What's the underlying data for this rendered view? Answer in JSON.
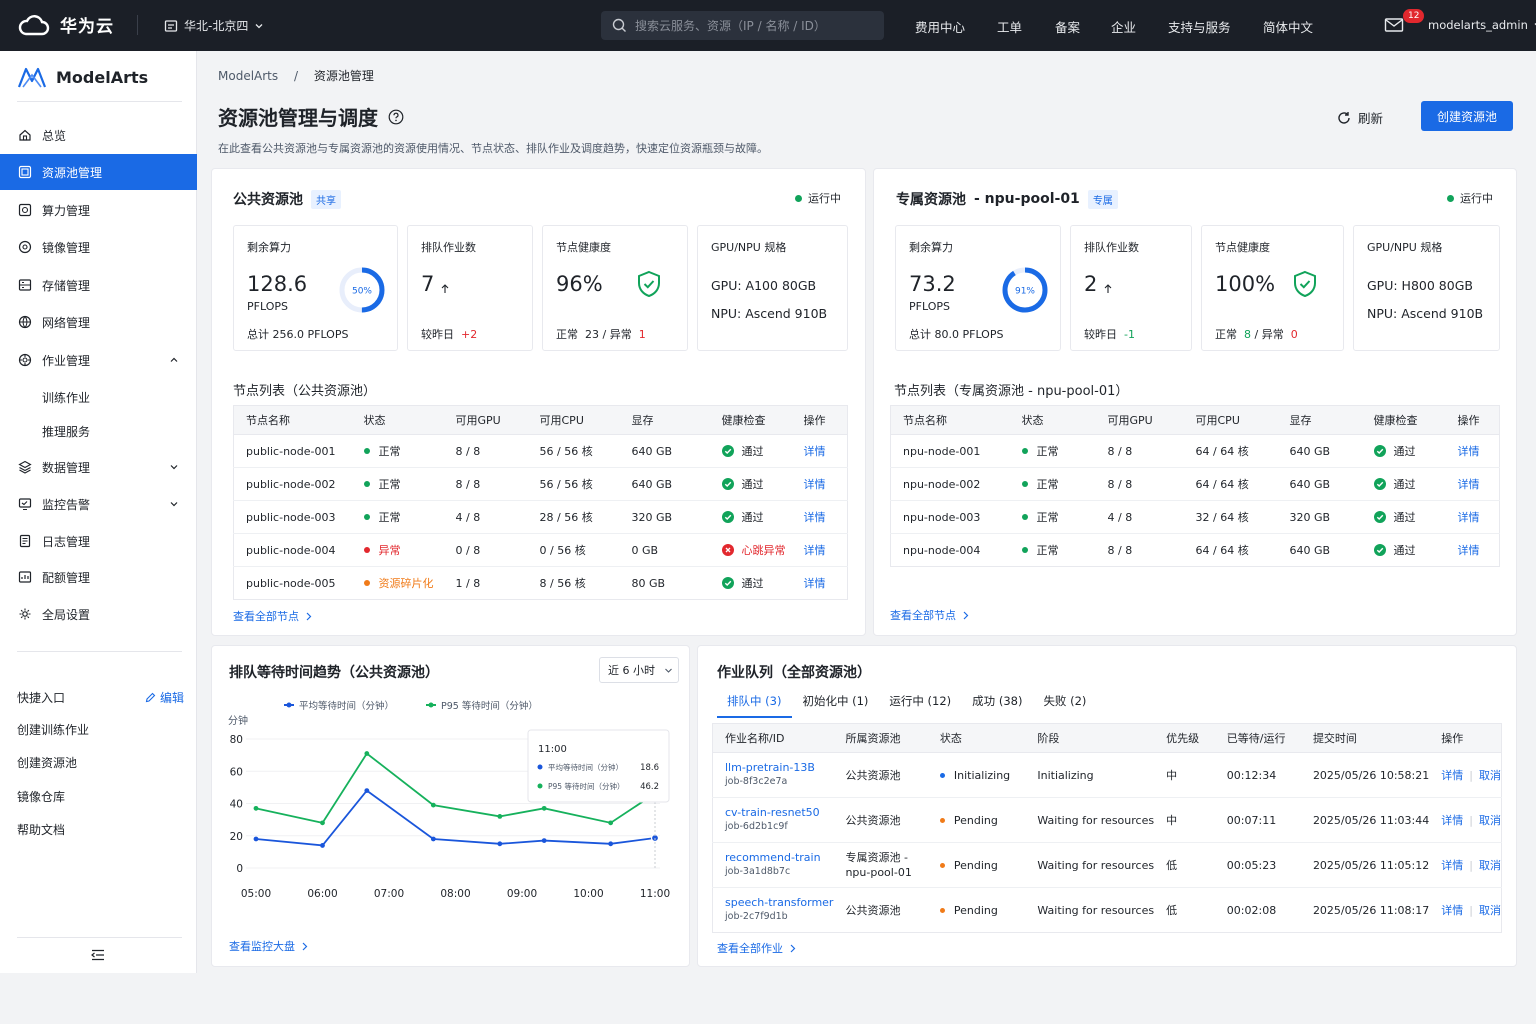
{
  "topbar": {
    "brand": "华为云",
    "region": "华北-北京四",
    "search_placeholder": "搜索云服务、资源（IP / 名称 / ID）",
    "nav": [
      "费用中心",
      "工单",
      "备案",
      "企业",
      "支持与服务",
      "简体中文"
    ],
    "mail_count": "12",
    "username": "modelarts_admin"
  },
  "sidebar": {
    "brand": "ModelArts",
    "items": [
      {
        "label": "总览",
        "icon": "home-icon"
      },
      {
        "label": "资源池管理",
        "icon": "resource-pool-icon"
      },
      {
        "label": "算力管理",
        "icon": "compute-icon"
      },
      {
        "label": "镜像管理",
        "icon": "image-icon"
      },
      {
        "label": "存储管理",
        "icon": "storage-icon"
      },
      {
        "label": "网络管理",
        "icon": "network-icon"
      },
      {
        "label": "作业管理",
        "icon": "job-icon"
      },
      {
        "label": "数据管理",
        "icon": "data-icon"
      },
      {
        "label": "监控告警",
        "icon": "monitor-icon"
      },
      {
        "label": "日志管理",
        "icon": "log-icon"
      },
      {
        "label": "配额管理",
        "icon": "quota-icon"
      },
      {
        "label": "全局设置",
        "icon": "settings-icon"
      }
    ],
    "job_sub": [
      "训练作业",
      "推理服务"
    ],
    "quick_title": "快捷入口",
    "quick_edit": "编辑",
    "quick_links": [
      "创建训练作业",
      "创建资源池",
      "镜像仓库",
      "帮助文档"
    ]
  },
  "breadcrumb": {
    "root": "ModelArts",
    "sep": "/",
    "current": "资源池管理"
  },
  "page": {
    "title": "资源池管理与调度",
    "desc": "在此查看公共资源池与专属资源池的资源使用情况、节点状态、排队作业及调度趋势，快速定位资源瓶颈与故障。",
    "refresh": "刷新",
    "create": "创建资源池"
  },
  "public_pool": {
    "title": "公共资源池",
    "tag": "共享",
    "status": "运行中",
    "remaining_label": "剩余算力",
    "remaining_value": "128.6",
    "remaining_unit": "PFLOPS",
    "ring_label": "50%",
    "ring_fraction": 0.5,
    "remaining_total": "总计 256.0 PFLOPS",
    "queue_label": "排队作业数",
    "queue_value": "7",
    "queue_delta_label": "较昨日",
    "queue_delta": "+2",
    "health_label": "节点健康度",
    "health_value": "96%",
    "health_normal_label": "正常",
    "health_normal": "23",
    "health_sep": "/",
    "health_abnormal_label": "异常",
    "health_abnormal": "1",
    "spec_label": "GPU/NPU 规格",
    "spec_gpu": "GPU:  A100 80GB",
    "spec_npu": "NPU:  Ascend 910B"
  },
  "dedicated_pool": {
    "title": "专属资源池",
    "pool_name": "- npu-pool-01",
    "tag": "专属",
    "status": "运行中",
    "remaining_label": "剩余算力",
    "remaining_value": "73.2",
    "remaining_unit": "PFLOPS",
    "ring_label": "91%",
    "ring_fraction": 0.91,
    "remaining_total": "总计 80.0 PFLOPS",
    "queue_label": "排队作业数",
    "queue_value": "2",
    "queue_delta_label": "较昨日",
    "queue_delta": "-1",
    "health_label": "节点健康度",
    "health_value": "100%",
    "health_normal_label": "正常",
    "health_normal": "8",
    "health_sep": "/",
    "health_abnormal_label": "异常",
    "health_abnormal": "0",
    "spec_label": "GPU/NPU 规格",
    "spec_gpu": "GPU:  H800 80GB",
    "spec_npu": "NPU:  Ascend 910B"
  },
  "public_nodes": {
    "title": "节点列表（公共资源池）",
    "headers": [
      "节点名称",
      "状态",
      "可用GPU",
      "可用CPU",
      "显存",
      "健康检查",
      "操作"
    ],
    "rows": [
      [
        "public-node-001",
        "正常",
        "8 / 8",
        "56 / 56 核",
        "640 GB",
        "通过",
        "详情"
      ],
      [
        "public-node-002",
        "正常",
        "8 / 8",
        "56 / 56 核",
        "640 GB",
        "通过",
        "详情"
      ],
      [
        "public-node-003",
        "正常",
        "4 / 8",
        "28 / 56 核",
        "320 GB",
        "通过",
        "详情"
      ],
      [
        "public-node-004",
        "异常",
        "0 / 8",
        "0 / 56 核",
        "0 GB",
        "心跳异常",
        "详情"
      ],
      [
        "public-node-005",
        "资源碎片化",
        "1 / 8",
        "8 / 56 核",
        "80 GB",
        "通过",
        "详情"
      ]
    ],
    "more": "查看全部节点"
  },
  "dedicated_nodes": {
    "title": "节点列表（专属资源池 - npu-pool-01）",
    "headers": [
      "节点名称",
      "状态",
      "可用GPU",
      "可用CPU",
      "显存",
      "健康检查",
      "操作"
    ],
    "rows": [
      [
        "npu-node-001",
        "正常",
        "8 / 8",
        "64 / 64 核",
        "640 GB",
        "通过",
        "详情"
      ],
      [
        "npu-node-002",
        "正常",
        "8 / 8",
        "64 / 64 核",
        "640 GB",
        "通过",
        "详情"
      ],
      [
        "npu-node-003",
        "正常",
        "4 / 8",
        "32 / 64 核",
        "320 GB",
        "通过",
        "详情"
      ],
      [
        "npu-node-004",
        "正常",
        "8 / 8",
        "64 / 64 核",
        "640 GB",
        "通过",
        "详情"
      ]
    ],
    "more": "查看全部节点"
  },
  "trend": {
    "title": "排队等待时间趋势（公共资源池）",
    "range": "近 6 小时",
    "more": "查看监控大盘",
    "tooltip_time": "11:00"
  },
  "chart_data": {
    "type": "line",
    "ylabel": "分钟",
    "ylim": [
      0,
      80
    ],
    "yticks": [
      0,
      20,
      40,
      60,
      80
    ],
    "x": [
      "05:00",
      "05:20",
      "05:40",
      "06:00",
      "06:20",
      "06:40",
      "07:00",
      "07:20",
      "07:40",
      "08:00",
      "08:20",
      "08:40",
      "09:00",
      "09:20",
      "09:40",
      "10:00",
      "10:20",
      "10:40",
      "11:00"
    ],
    "xticks": [
      "05:00",
      "06:00",
      "07:00",
      "08:00",
      "09:00",
      "10:00",
      "11:00"
    ],
    "legend_position": "top",
    "series": [
      {
        "name": "平均等待时间（分钟）",
        "color": "#1a56db",
        "values": [
          18,
          null,
          null,
          14,
          null,
          48,
          null,
          null,
          18,
          null,
          null,
          15,
          null,
          17,
          null,
          null,
          15,
          null,
          18.6
        ],
        "tooltip": "18.6"
      },
      {
        "name": "P95 等待时间（分钟）",
        "color": "#16b15c",
        "values": [
          37,
          null,
          null,
          28,
          null,
          71,
          null,
          null,
          39,
          null,
          null,
          32,
          null,
          37,
          null,
          null,
          28,
          null,
          46.2
        ],
        "tooltip": "46.2"
      }
    ]
  },
  "job_queue": {
    "title": "作业队列（全部资源池）",
    "tabs": [
      "排队中 (3)",
      "初始化中 (1)",
      "运行中 (12)",
      "成功 (38)",
      "失败 (2)"
    ],
    "headers": [
      "作业名称/ID",
      "所属资源池",
      "状态",
      "阶段",
      "优先级",
      "已等待/运行",
      "提交时间",
      "操作"
    ],
    "rows": [
      {
        "name": "llm-pretrain-13B",
        "id": "job-8f3c2e7a",
        "pool": "公共资源池",
        "pool2": "",
        "status": "Initializing",
        "stage": "Initializing",
        "priority": "中",
        "wait": "00:12:34",
        "time": "2025/05/26 10:58:21",
        "a1": "详情",
        "a2": "取消",
        "color": "#1a6ae5"
      },
      {
        "name": "cv-train-resnet50",
        "id": "job-6d2b1c9f",
        "pool": "公共资源池",
        "pool2": "",
        "status": "Pending",
        "stage": "Waiting for resources",
        "priority": "中",
        "wait": "00:07:11",
        "time": "2025/05/26 11:03:44",
        "a1": "详情",
        "a2": "取消",
        "color": "#f07b19"
      },
      {
        "name": "recommend-train",
        "id": "job-3a1d8b7c",
        "pool": "专属资源池 -",
        "pool2": "npu-pool-01",
        "status": "Pending",
        "stage": "Waiting for resources",
        "priority": "低",
        "wait": "00:05:23",
        "time": "2025/05/26 11:05:12",
        "a1": "详情",
        "a2": "取消",
        "color": "#f07b19"
      },
      {
        "name": "speech-transformer",
        "id": "job-2c7f9d1b",
        "pool": "公共资源池",
        "pool2": "",
        "status": "Pending",
        "stage": "Waiting for resources",
        "priority": "低",
        "wait": "00:02:08",
        "time": "2025/05/26 11:08:17",
        "a1": "详情",
        "a2": "取消",
        "color": "#f07b19"
      }
    ],
    "more": "查看全部作业"
  },
  "colors": {
    "accent": "#1a6ae5",
    "ok": "#11a35a",
    "error": "#e2282e",
    "warn": "#f07b19"
  }
}
